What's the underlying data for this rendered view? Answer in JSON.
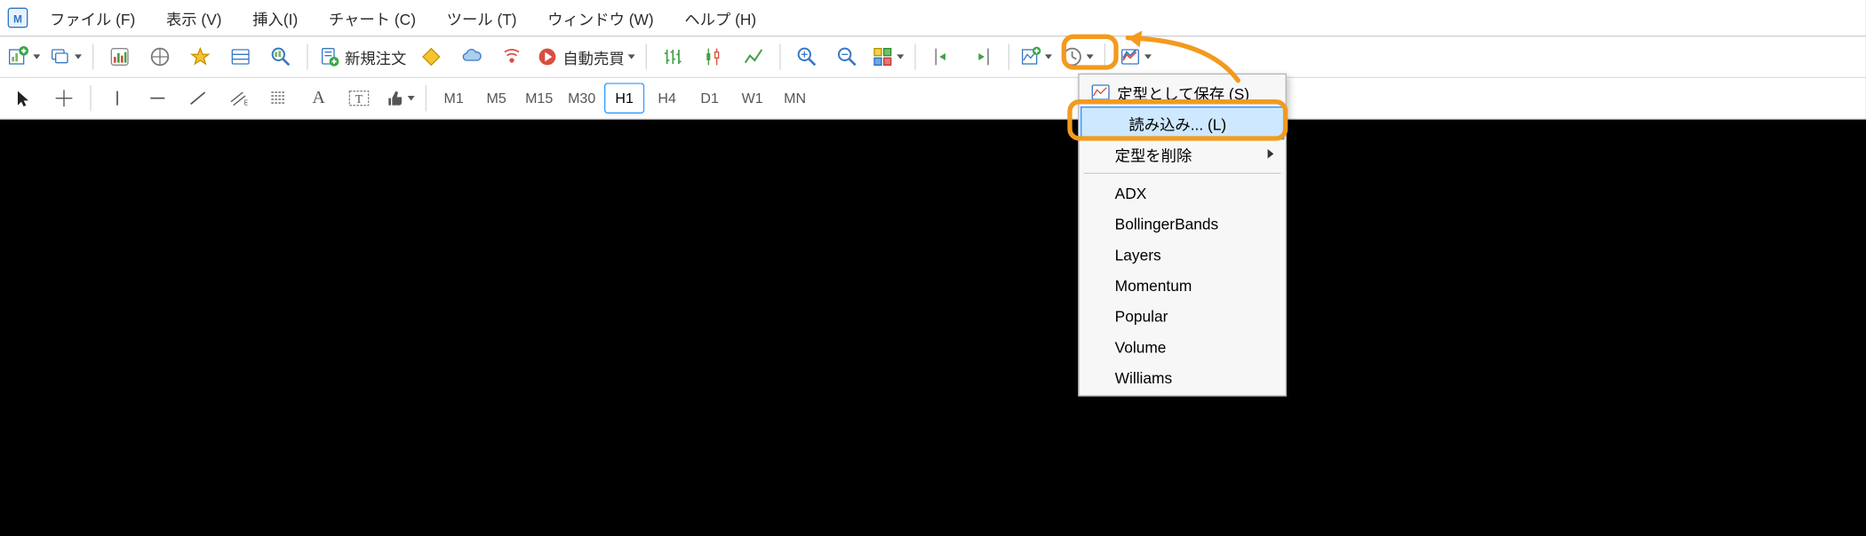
{
  "menu": {
    "file": "ファイル (F)",
    "view": "表示 (V)",
    "insert": "挿入(I)",
    "chart": "チャート (C)",
    "tools": "ツール (T)",
    "window": "ウィンドウ (W)",
    "help": "ヘルプ (H)"
  },
  "toolbar1": {
    "new_order": "新規注文",
    "auto_trade": "自動売買"
  },
  "timeframes": {
    "m1": "M1",
    "m5": "M5",
    "m15": "M15",
    "m30": "M30",
    "h1": "H1",
    "h4": "H4",
    "d1": "D1",
    "w1": "W1",
    "mn": "MN"
  },
  "dropdown": {
    "save_as": "定型として保存 (S)",
    "load": "読み込み... (L)",
    "delete": "定型を削除",
    "presets": {
      "adx": "ADX",
      "bb": "BollingerBands",
      "layers": "Layers",
      "momentum": "Momentum",
      "popular": "Popular",
      "volume": "Volume",
      "williams": "Williams"
    }
  }
}
